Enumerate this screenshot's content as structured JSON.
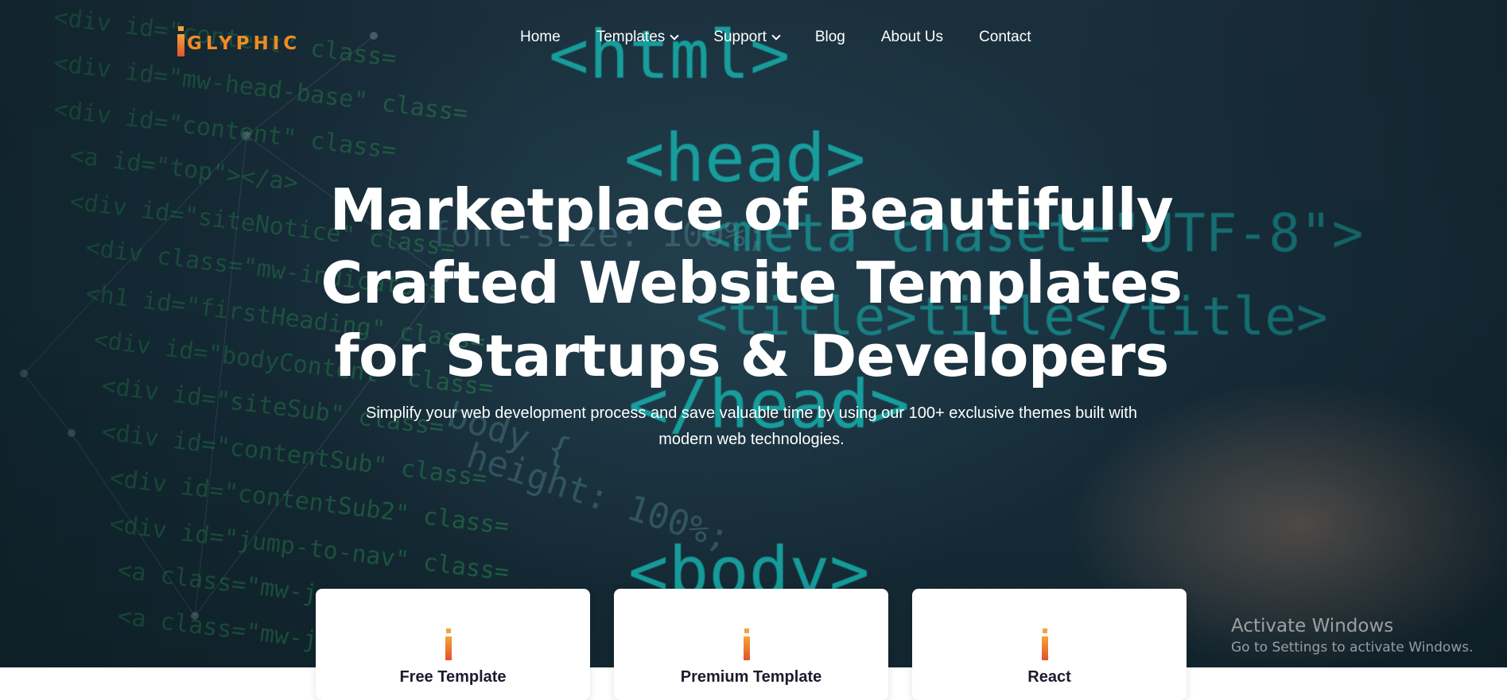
{
  "brand": {
    "logo_text": "GLYPHIC",
    "accent": "#f08a24"
  },
  "nav": {
    "items": [
      {
        "label": "Home",
        "dropdown": false
      },
      {
        "label": "Templates",
        "dropdown": true
      },
      {
        "label": "Support",
        "dropdown": true
      },
      {
        "label": "Blog",
        "dropdown": false
      },
      {
        "label": "About Us",
        "dropdown": false
      },
      {
        "label": "Contact",
        "dropdown": false
      }
    ]
  },
  "hero": {
    "headline_lines": [
      "Marketplace of Beautifully",
      "Crafted Website Templates",
      "for Startups & Developers"
    ],
    "subtitle_lines": [
      "Simplify your web development process and save valuable time by using our 100+ exclusive themes built with",
      "modern web technologies."
    ]
  },
  "cards": [
    {
      "title": "Free Template",
      "icon": "glyphic-i-icon"
    },
    {
      "title": "Premium Template",
      "icon": "glyphic-i-icon"
    },
    {
      "title": "React",
      "icon": "glyphic-i-icon"
    }
  ],
  "watermark": {
    "title": "Activate Windows",
    "subtitle": "Go to Settings to activate Windows."
  },
  "background_code": {
    "left_lines": [
      "<div id=\"content\" class=",
      "<div id=\"mw-head-base\" class=",
      "<div id=\"content\" class=",
      "<a id=\"top\"></a>",
      "<div id=\"siteNotice\" class=",
      "<div class=\"mw-indicators",
      "<h1 id=\"firstHeading\" class=",
      "<div id=\"bodyContent\" class=",
      "<div id=\"siteSub\" class=",
      "<div id=\"contentSub\" class=",
      "<div id=\"contentSub2\" class=",
      "<div id=\"jump-to-nav\" class=",
      "<a class=\"mw-jump-link\"",
      "<a class=\"mw-jump-link\""
    ],
    "big_tags": [
      "<html>",
      "<head>",
      "<meta chaset=\"UTF-8\">",
      "<title>title</title>",
      "</head>",
      "<body>"
    ],
    "mid_text": [
      "font-size: 100%;",
      "body {",
      "height: 100%;"
    ]
  }
}
